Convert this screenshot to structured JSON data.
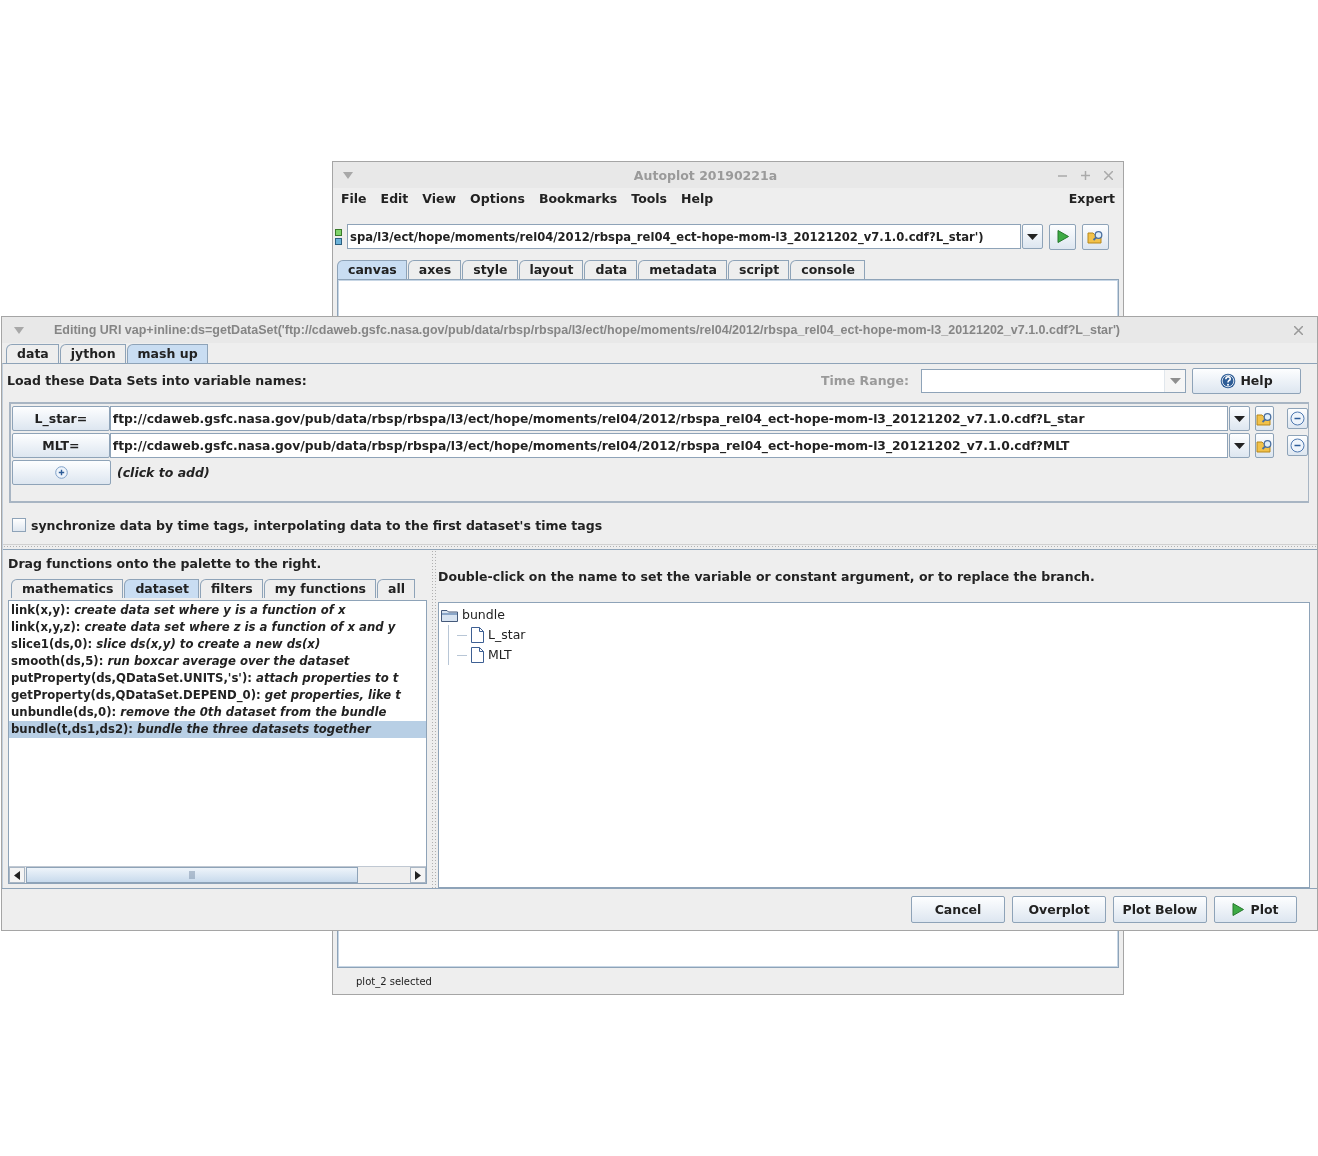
{
  "main_window": {
    "title": "Autoplot 20190221a",
    "menu": [
      "File",
      "Edit",
      "View",
      "Options",
      "Bookmarks",
      "Tools",
      "Help"
    ],
    "menu_right": "Expert",
    "uri": "spa/l3/ect/hope/moments/rel04/2012/rbspa_rel04_ect-hope-mom-l3_20121202_v7.1.0.cdf?L_star')",
    "tabs": [
      {
        "label": "canvas",
        "selected": true
      },
      {
        "label": "axes",
        "selected": false
      },
      {
        "label": "style",
        "selected": false
      },
      {
        "label": "layout",
        "selected": false
      },
      {
        "label": "data",
        "selected": false
      },
      {
        "label": "metadata",
        "selected": false
      },
      {
        "label": "script",
        "selected": false
      },
      {
        "label": "console",
        "selected": false
      }
    ],
    "status": "plot_2 selected"
  },
  "dialog": {
    "title": "Editing URI vap+inline:ds=getDataSet('ftp://cdaweb.gsfc.nasa.gov/pub/data/rbsp/rbspa/l3/ect/hope/moments/rel04/2012/rbspa_rel04_ect-hope-mom-l3_20121202_v7.1.0.cdf?L_star')",
    "tabs": [
      {
        "label": "data",
        "selected": false
      },
      {
        "label": "jython",
        "selected": false
      },
      {
        "label": "mash up",
        "selected": true
      }
    ],
    "load_label": "Load these Data Sets into variable names:",
    "time_range": {
      "label": "Time Range:",
      "disabled": true
    },
    "help_button": "Help",
    "datasets": [
      {
        "name": "L_star=",
        "uri": "ftp://cdaweb.gsfc.nasa.gov/pub/data/rbsp/rbspa/l3/ect/hope/moments/rel04/2012/rbspa_rel04_ect-hope-mom-l3_20121202_v7.1.0.cdf?L_star"
      },
      {
        "name": "MLT=",
        "uri": "ftp://cdaweb.gsfc.nasa.gov/pub/data/rbsp/rbspa/l3/ect/hope/moments/rel04/2012/rbspa_rel04_ect-hope-mom-l3_20121202_v7.1.0.cdf?MLT"
      }
    ],
    "add_hint": "(click to add)",
    "sync": {
      "label": "synchronize data by time tags, interpolating data to the first dataset's time tags",
      "checked": false
    },
    "palette_hint": "Drag functions onto the palette to the right.",
    "palette_tabs": [
      {
        "label": "mathematics",
        "selected": false
      },
      {
        "label": "dataset",
        "selected": true
      },
      {
        "label": "filters",
        "selected": false
      },
      {
        "label": "my functions",
        "selected": false
      },
      {
        "label": "all",
        "selected": false
      }
    ],
    "functions": [
      {
        "text": "link(x,y): *create data set where y is a function of x*",
        "selected": false
      },
      {
        "text": "link(x,y,z): *create data set where z is a function of x and y*",
        "selected": false
      },
      {
        "text": "slice1(ds,0): *slice ds(x,y) to create a new ds(x)*",
        "selected": false
      },
      {
        "text": "smooth(ds,5): *run boxcar average over the dataset*",
        "selected": false
      },
      {
        "text": "putProperty(ds,QDataSet.UNITS,'s'): *attach properties to t*",
        "selected": false
      },
      {
        "text": "getProperty(ds,QDataSet.DEPEND_0): *get properties, like t*",
        "selected": false
      },
      {
        "text": "unbundle(ds,0): *remove the 0th dataset from the bundle*",
        "selected": false
      },
      {
        "text": "bundle(t,ds1,ds2): *bundle the three datasets together*",
        "selected": true
      }
    ],
    "tree_hint": "Double-click on the name to set the variable or constant argument, or to replace the branch.",
    "tree": [
      {
        "label": "bundle",
        "children": [
          {
            "label": "L_star"
          },
          {
            "label": "MLT"
          }
        ]
      }
    ],
    "buttons": [
      {
        "label": "Cancel",
        "kind": "plain"
      },
      {
        "label": "Overplot",
        "kind": "plain"
      },
      {
        "label": "Plot Below",
        "kind": "plain"
      },
      {
        "label": "Plot",
        "kind": "play"
      }
    ]
  }
}
